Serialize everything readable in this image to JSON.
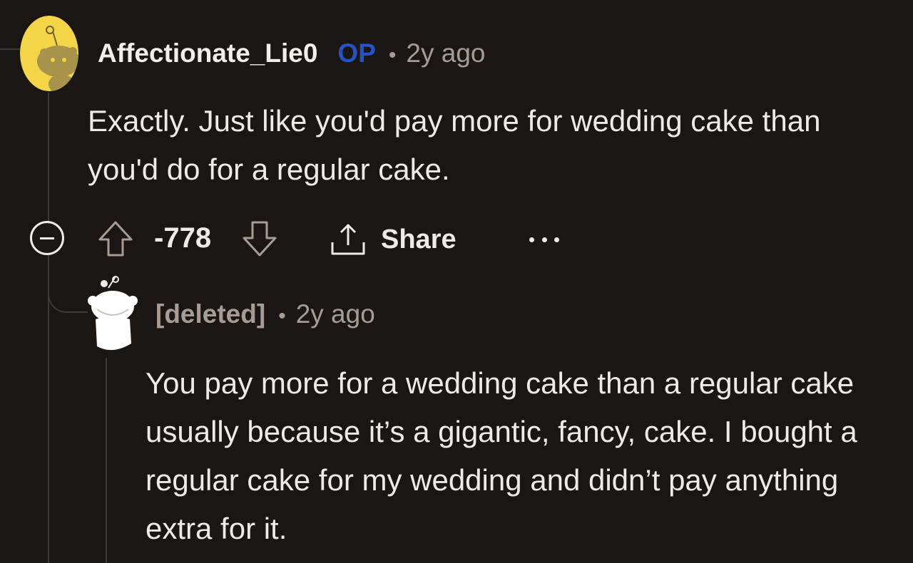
{
  "comment": {
    "author": "Affectionate_Lie0",
    "op_badge": "OP",
    "separator": "•",
    "time": "2y ago",
    "body": "Exactly. Just like you'd pay more for wedding cake than you'd do for a regular cake.",
    "score": "-778",
    "share_label": "Share",
    "avatar_color": "#f4d547"
  },
  "reply": {
    "author": "[deleted]",
    "separator": "•",
    "time": "2y ago",
    "body": "You pay more for a wedding cake than a regular cake usually because it’s a gigantic, fancy, cake. I bought a regular cake for my wedding and didn’t pay anything extra for it."
  },
  "colors": {
    "background": "#1a1614",
    "op_badge": "#2553c7",
    "meta_text": "#a69c94"
  },
  "icons": {
    "collapse": "minus-circle-icon",
    "upvote": "arrow-up-icon",
    "downvote": "arrow-down-icon",
    "share": "share-icon",
    "more": "ellipsis-icon"
  }
}
